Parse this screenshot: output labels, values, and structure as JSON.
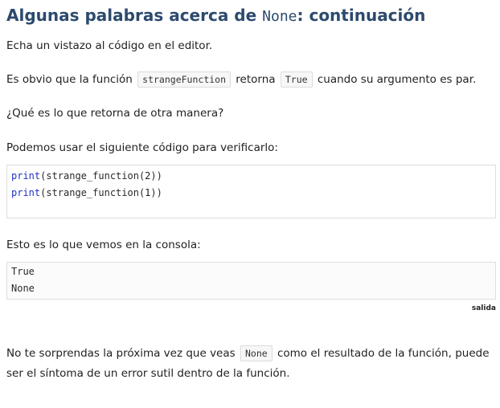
{
  "heading": {
    "prefix": "Algunas palabras acerca de ",
    "code": "None",
    "suffix": ": continuación"
  },
  "paragraphs": {
    "intro": "Echa un vistazo al código en el editor.",
    "obvious_before": "Es obvio que la función ",
    "obvious_code1": "strangeFunction",
    "obvious_mid": " retorna ",
    "obvious_code2": "True",
    "obvious_after": " cuando su argumento es par.",
    "question": "¿Qué es lo que retorna de otra manera?",
    "verify": "Podemos usar el siguiente código para verificarlo:",
    "console_intro": "Esto es lo que vemos en la consola:",
    "final_before": "No te sorprendas la próxima vez que veas ",
    "final_code": "None",
    "final_after": " como el resultado de la función, puede ser el síntoma de un error sutil dentro de la función."
  },
  "editor": {
    "lines": [
      {
        "keyword": "print",
        "open": "(strange_function(",
        "arg": "2",
        "close": "))"
      },
      {
        "keyword": "print",
        "open": "(strange_function(",
        "arg": "1",
        "close": "))"
      }
    ]
  },
  "console": {
    "lines": [
      "True",
      "None"
    ],
    "label": "salida"
  }
}
